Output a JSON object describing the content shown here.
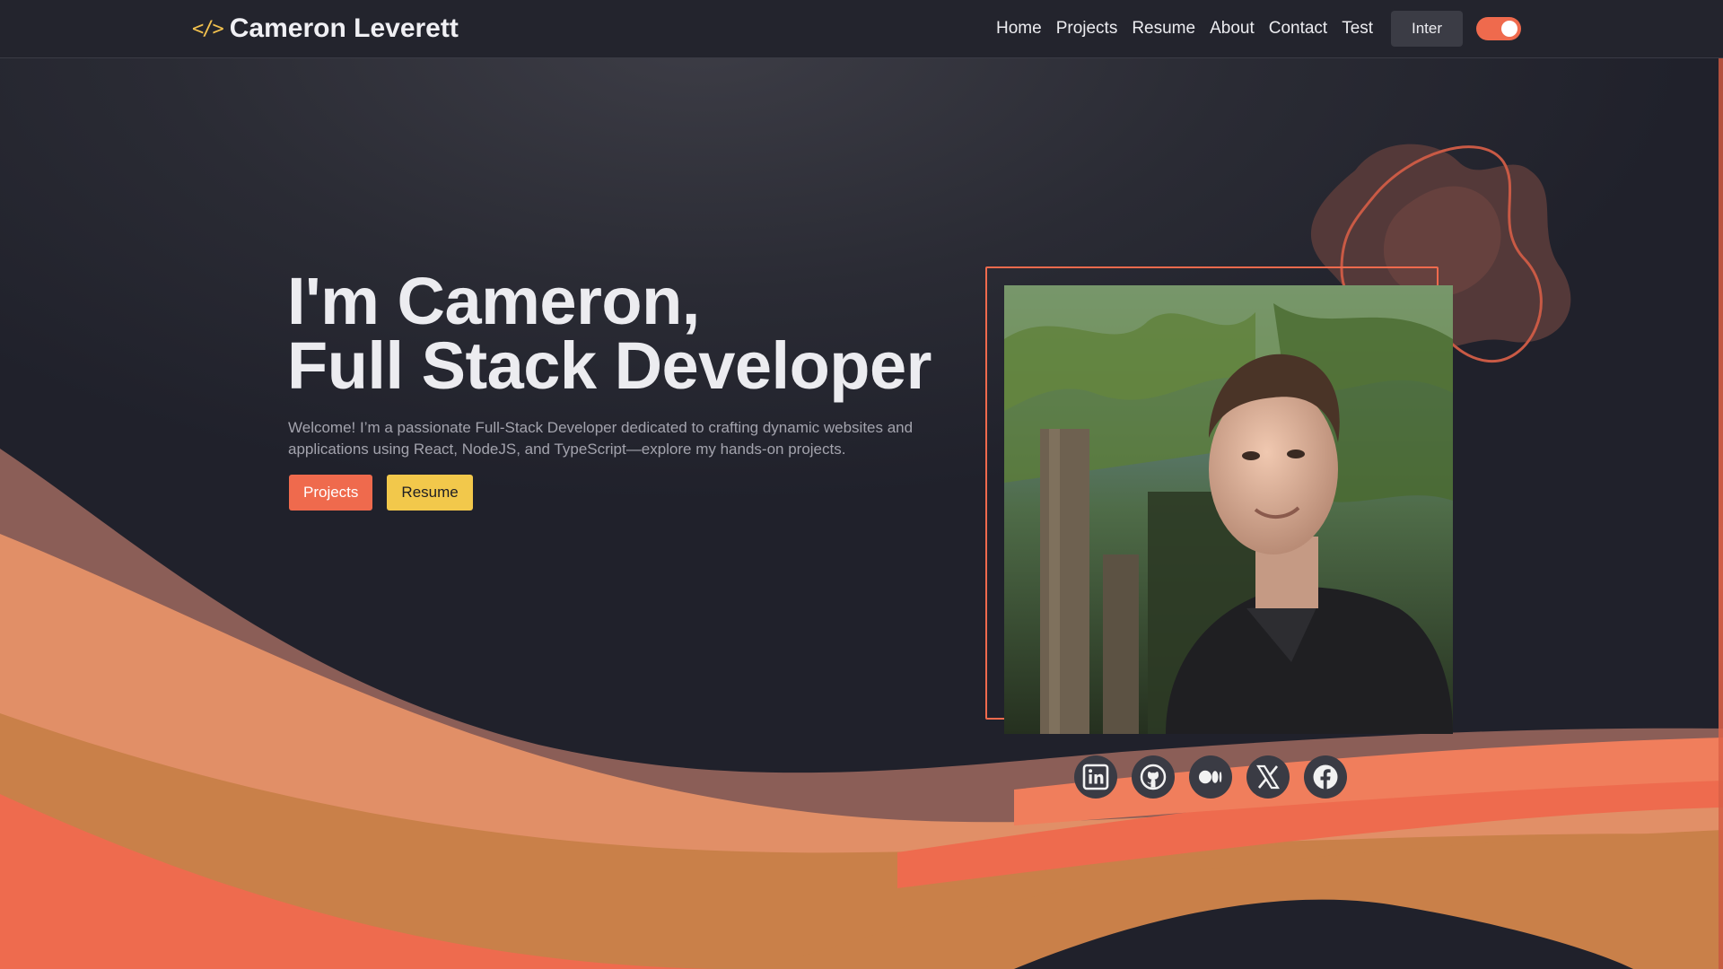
{
  "nav": {
    "brand_icon": "</>",
    "brand_name": "Cameron Leverett",
    "links": [
      "Home",
      "Projects",
      "Resume",
      "About",
      "Contact",
      "Test"
    ],
    "font_button": "Inter",
    "theme_toggle": "on"
  },
  "hero": {
    "title_line1": "I'm Cameron,",
    "title_line2": "Full Stack Developer",
    "description": "Welcome! I’m a passionate Full-Stack Developer dedicated to crafting dynamic websites and applications using React, NodeJS, and TypeScript—explore my hands-on projects.",
    "projects_button": "Projects",
    "resume_button": "Resume"
  },
  "social": [
    "linkedin-icon",
    "github-icon",
    "medium-icon",
    "x-icon",
    "facebook-icon"
  ],
  "colors": {
    "accent": "#ef6a4d",
    "secondary": "#f2c84b",
    "background": "#20212b",
    "wave_mauve": "#8b5e57",
    "wave_peach": "#e18f67",
    "wave_tan": "#c98049"
  }
}
